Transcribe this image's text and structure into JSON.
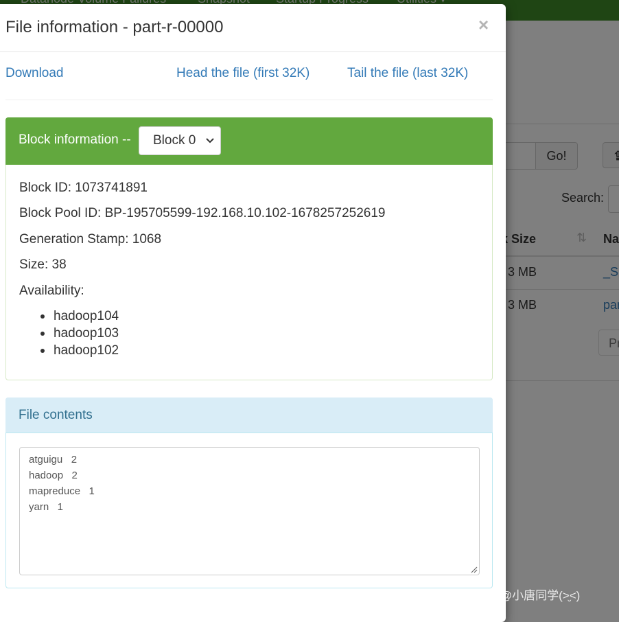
{
  "background": {
    "nav_items": [
      "Datanode Volume Failures",
      "Snapshot",
      "Startup Progress",
      "Utilities ▾"
    ],
    "go_label": "Go!",
    "search_label": "Search:",
    "column_header": "ck Size",
    "column_header_2": "Na",
    "rows": [
      {
        "size": "3 MB",
        "name": "_SU"
      },
      {
        "size": "3 MB",
        "name": "par"
      }
    ],
    "pager_label": "Pr"
  },
  "modal": {
    "title": "File information - part-r-00000",
    "close_label": "×",
    "links": {
      "download": "Download",
      "head": "Head the file (first 32K)",
      "tail": "Tail the file (last 32K)"
    },
    "block_panel": {
      "label": "Block information --",
      "selected_block": "Block 0",
      "block_id": "Block ID: 1073741891",
      "block_pool_id": "Block Pool ID: BP-195705599-192.168.10.102-1678257252619",
      "generation_stamp": "Generation Stamp: 1068",
      "size": "Size: 38",
      "availability_label": "Availability:",
      "availability": [
        "hadoop104",
        "hadoop103",
        "hadoop102"
      ]
    },
    "contents_panel": {
      "title": "File contents",
      "lines": [
        "atguigu\t2",
        "hadoop\t2",
        "mapreduce\t1",
        "yarn\t1"
      ]
    }
  },
  "watermark": "CSDN @小唐同学(>̮<)",
  "colors": {
    "navbar": "#3f8a28",
    "block_heading": "#62a83e",
    "info_heading": "#d9edf7",
    "link": "#337ab7"
  }
}
